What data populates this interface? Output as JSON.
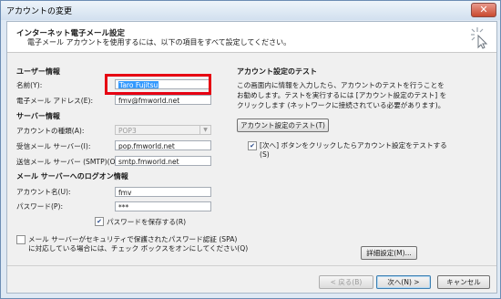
{
  "window": {
    "title": "アカウントの変更",
    "close": "✕"
  },
  "header": {
    "title": "インターネット電子メール設定",
    "description": "電子メール アカウントを使用するには、以下の項目をすべて設定してください。",
    "icon": "sparkle-cursor-icon"
  },
  "user_info": {
    "heading": "ユーザー情報",
    "name_label": "名前(Y):",
    "name_value": "Taro Fujitsu",
    "email_label": "電子メール アドレス(E):",
    "email_value": "fmv@fmworld.net"
  },
  "server_info": {
    "heading": "サーバー情報",
    "account_type_label": "アカウントの種類(A):",
    "account_type_value": "POP3",
    "incoming_label": "受信メール サーバー(I):",
    "incoming_value": "pop.fmworld.net",
    "outgoing_label": "送信メール サーバー (SMTP)(O):",
    "outgoing_value": "smtp.fmworld.net"
  },
  "logon_info": {
    "heading": "メール サーバーへのログオン情報",
    "account_name_label": "アカウント名(U):",
    "account_name_value": "fmv",
    "password_label": "パスワード(P):",
    "password_value": "***",
    "save_password_label": "パスワードを保存する(R)",
    "save_password_checked": true,
    "spa_label_line1": "メール サーバーがセキュリティで保護されたパスワード認証 (SPA)",
    "spa_label_line2": "に対応している場合には、チェック ボックスをオンにしてください(Q)",
    "spa_checked": false
  },
  "test": {
    "heading": "アカウント設定のテスト",
    "desc_line1": "この画面内に情報を入力したら、アカウントのテストを行うことを",
    "desc_line2": "お勧めします。テストを実行するには [アカウント設定のテスト] を",
    "desc_line3": "クリックします (ネットワークに接続されている必要があります)。",
    "test_button": "アカウント設定のテスト(T)",
    "next_check_line1": "[次へ] ボタンをクリックしたらアカウント設定をテストする",
    "next_check_line2": "(S)",
    "next_check_checked": true,
    "advanced_button": "詳細設定(M)..."
  },
  "footer": {
    "back_button": "< 戻る(B)",
    "next_button": "次へ(N) >",
    "cancel_button": "キャンセル"
  }
}
